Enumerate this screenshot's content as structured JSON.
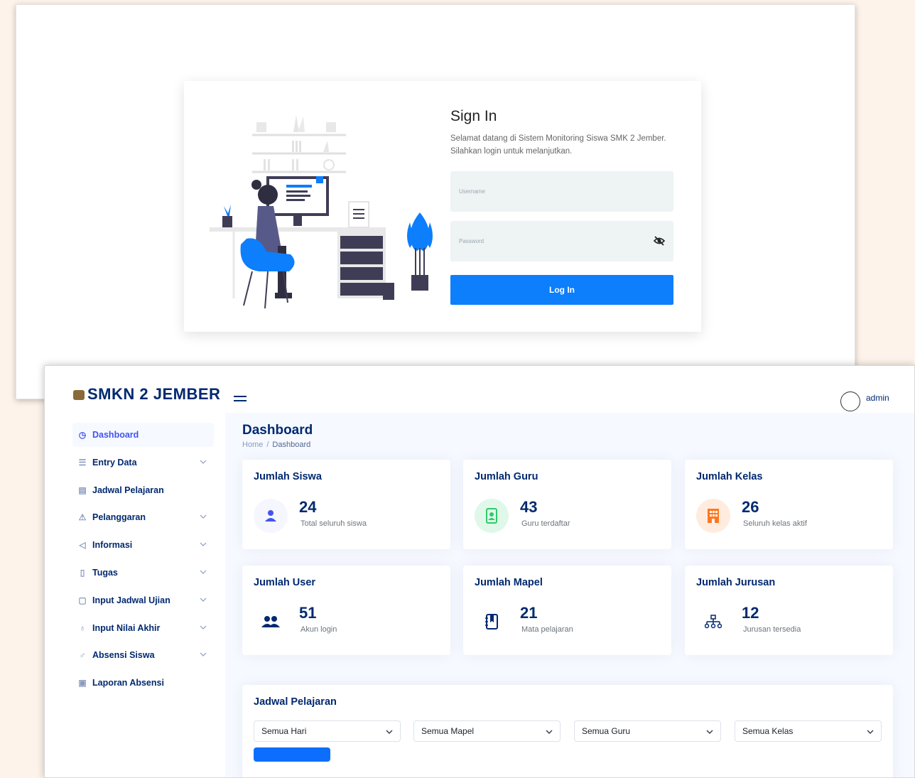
{
  "login": {
    "title": "Sign In",
    "subtitle": "Selamat datang di Sistem Monitoring Siswa SMK 2 Jember. Silahkan login untuk melanjutkan.",
    "username_placeholder": "Username",
    "password_placeholder": "Password",
    "button_label": "Log In",
    "button_color": "#0d7efc"
  },
  "dashboard": {
    "brand": "SMKN 2 JEMBER",
    "user_name": "admin",
    "sidebar": {
      "items": [
        {
          "label": "Dashboard",
          "icon": "speedometer-icon",
          "glyph": "◷"
        },
        {
          "label": "Entry Data",
          "icon": "database-icon",
          "glyph": "☰"
        },
        {
          "label": "Jadwal Pelajaran",
          "icon": "calendar-icon",
          "glyph": "▤"
        },
        {
          "label": "Pelanggaran",
          "icon": "warning-icon",
          "glyph": "⚠"
        },
        {
          "label": "Informasi",
          "icon": "megaphone-icon",
          "glyph": "◁"
        },
        {
          "label": "Tugas",
          "icon": "clipboard-icon",
          "glyph": "▯"
        },
        {
          "label": "Input Jadwal Ujian",
          "icon": "document-icon",
          "glyph": "▢"
        },
        {
          "label": "Input Nilai Akhir",
          "icon": "award-icon",
          "glyph": "♁"
        },
        {
          "label": "Absensi Siswa",
          "icon": "people-icon",
          "glyph": "♂"
        },
        {
          "label": "Laporan Absensi",
          "icon": "report-icon",
          "glyph": "▣"
        }
      ]
    },
    "page_title": "Dashboard",
    "breadcrumb": {
      "home": "Home",
      "separator": "/",
      "current": "Dashboard"
    },
    "stats": [
      {
        "title": "Jumlah Siswa",
        "value": "24",
        "desc": "Total seluruh siswa",
        "icon": "person-icon",
        "bg": "#f6f6fe",
        "fg": "#4154f1"
      },
      {
        "title": "Jumlah Guru",
        "value": "43",
        "desc": "Guru terdaftar",
        "icon": "badge-icon",
        "bg": "#e0f8e9",
        "fg": "#2eca6a"
      },
      {
        "title": "Jumlah Kelas",
        "value": "26",
        "desc": "Seluruh kelas aktif",
        "icon": "building-icon",
        "bg": "#ffecdf",
        "fg": "#ff771d"
      },
      {
        "title": "Jumlah User",
        "value": "51",
        "desc": "Akun login",
        "icon": "people-fill-icon",
        "bg": "#ffffff",
        "fg": "#012970"
      },
      {
        "title": "Jumlah Mapel",
        "value": "21",
        "desc": "Mata pelajaran",
        "icon": "journal-icon",
        "bg": "#ffffff",
        "fg": "#012970"
      },
      {
        "title": "Jumlah Jurusan",
        "value": "12",
        "desc": "Jurusan tersedia",
        "icon": "diagram-icon",
        "bg": "#ffffff",
        "fg": "#012970"
      }
    ],
    "schedule": {
      "title": "Jadwal Pelajaran",
      "filters": [
        "Semua Hari",
        "Semua Mapel",
        "Semua Guru",
        "Semua Kelas"
      ]
    }
  }
}
